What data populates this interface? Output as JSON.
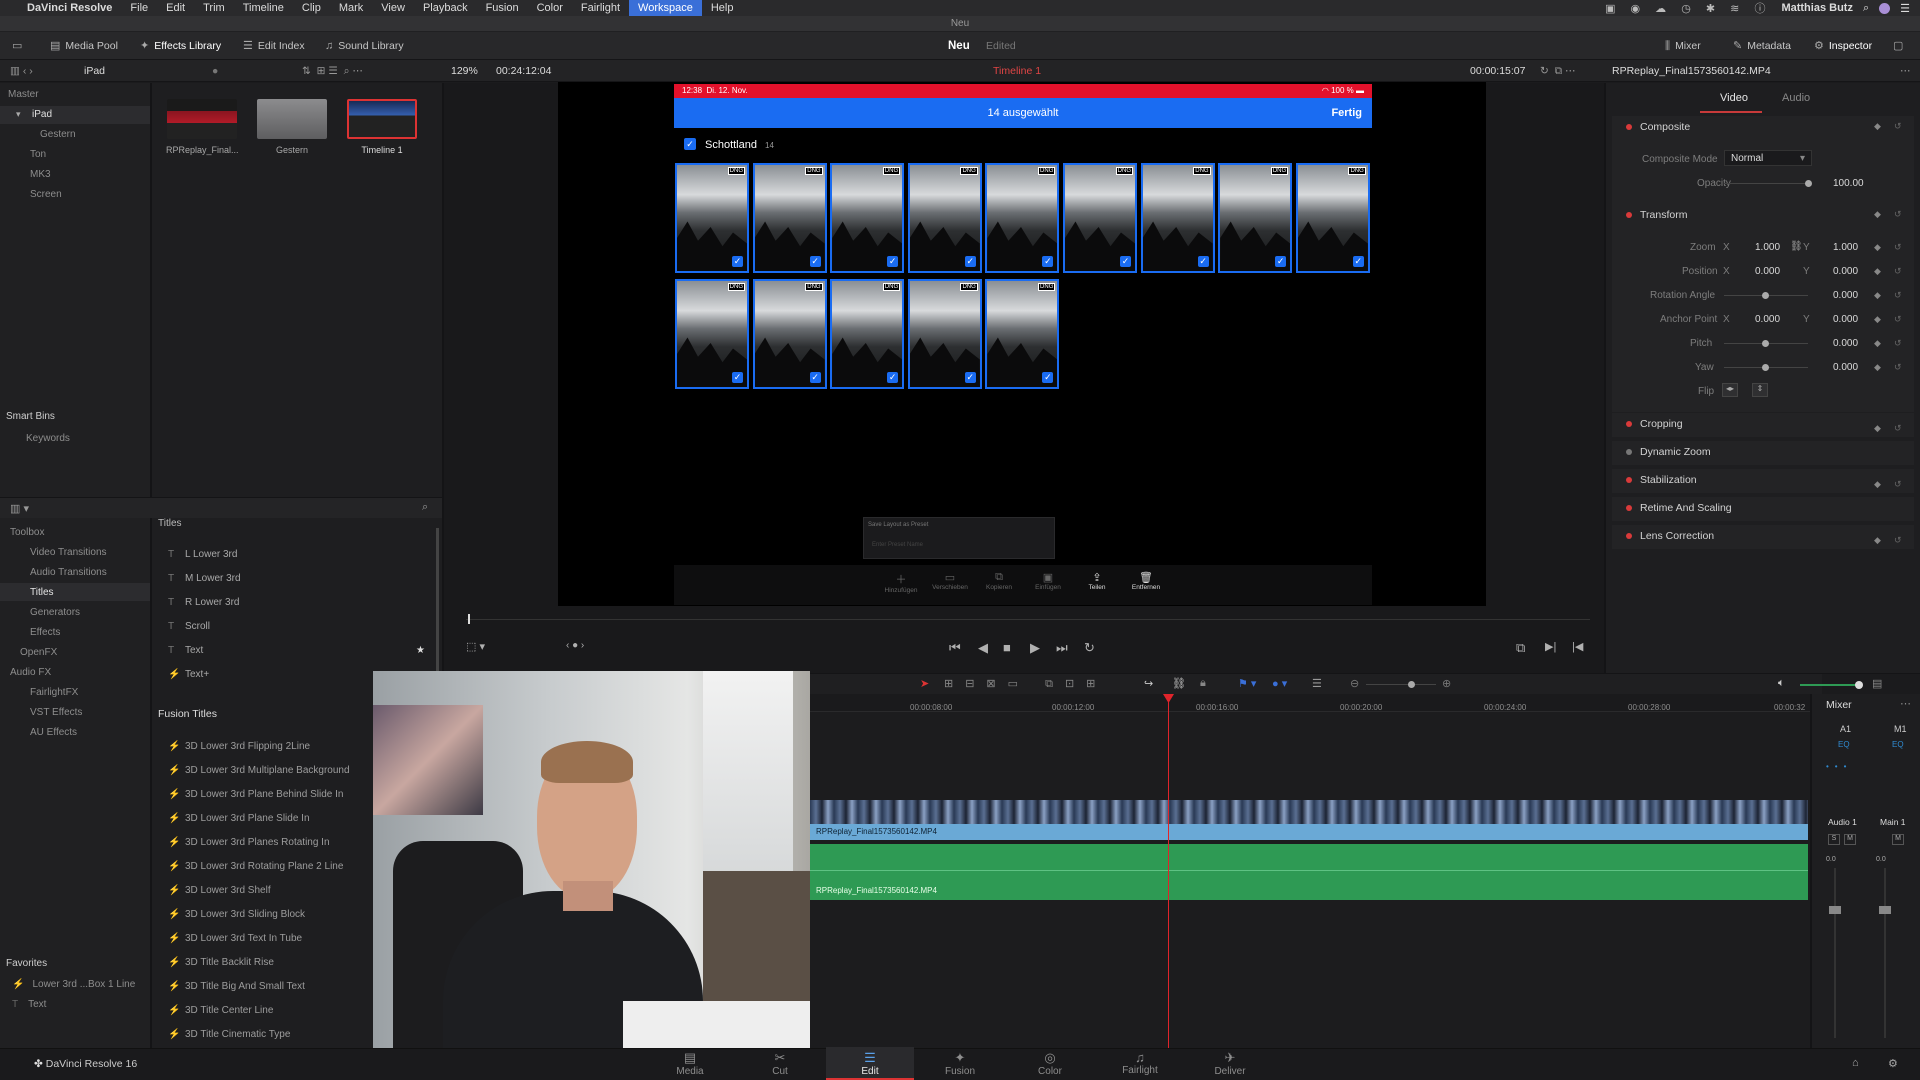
{
  "menubar": {
    "apple": "",
    "app": "DaVinci Resolve",
    "items": [
      "File",
      "Edit",
      "Trim",
      "Timeline",
      "Clip",
      "Mark",
      "View",
      "Playback",
      "Fusion",
      "Color",
      "Fairlight",
      "Workspace",
      "Help"
    ],
    "selected": "Workspace",
    "user": "Matthias Butz"
  },
  "window_title": "Neu",
  "toolbar": {
    "media_pool": "Media Pool",
    "effects_library": "Effects Library",
    "edit_index": "Edit Index",
    "sound_library": "Sound Library",
    "project": "Neu",
    "status": "Edited",
    "mixer": "Mixer",
    "metadata": "Metadata",
    "inspector": "Inspector"
  },
  "subbar": {
    "bin": "iPad",
    "zoom": "129%",
    "timecode_left": "00:24:12:04",
    "timeline": "Timeline 1",
    "timecode_right": "00:00:15:07",
    "clip_name": "RPReplay_Final1573560142.MP4"
  },
  "media_pool": {
    "bins": [
      "Master",
      "iPad",
      "Gestern",
      "Ton",
      "MK3",
      "Screen"
    ],
    "selected_bin": "iPad",
    "clips": [
      {
        "name": "RPReplay_Final..."
      },
      {
        "name": "Gestern"
      },
      {
        "name": "Timeline 1"
      }
    ],
    "smart_bins": "Smart Bins",
    "keywords": "Keywords"
  },
  "effects": {
    "tree": [
      {
        "label": "Toolbox",
        "level": 0
      },
      {
        "label": "Video Transitions",
        "level": 1
      },
      {
        "label": "Audio Transitions",
        "level": 1
      },
      {
        "label": "Titles",
        "level": 1
      },
      {
        "label": "Generators",
        "level": 1
      },
      {
        "label": "Effects",
        "level": 1
      },
      {
        "label": "OpenFX",
        "level": 0
      },
      {
        "label": "Audio FX",
        "level": 0
      },
      {
        "label": "FairlightFX",
        "level": 1
      },
      {
        "label": "VST Effects",
        "level": 1
      },
      {
        "label": "AU Effects",
        "level": 1
      }
    ],
    "selected": "Titles",
    "titles_header": "Titles",
    "titles": [
      "L Lower 3rd",
      "M Lower 3rd",
      "R Lower 3rd",
      "Scroll",
      "Text",
      "Text+"
    ],
    "fusion_titles_header": "Fusion Titles",
    "fusion_titles": [
      "3D Lower 3rd Flipping 2Line",
      "3D Lower 3rd Multiplane Background",
      "3D Lower 3rd Plane Behind Slide In",
      "3D Lower 3rd Plane Slide In",
      "3D Lower 3rd Planes Rotating In",
      "3D Lower 3rd Rotating Plane 2 Line",
      "3D Lower 3rd Shelf",
      "3D Lower 3rd Sliding Block",
      "3D Lower 3rd Text In Tube",
      "3D Title Backlit Rise",
      "3D Title Big And Small Text",
      "3D Title Center Line",
      "3D Title Cinematic Type"
    ],
    "favorites_header": "Favorites",
    "favorites": [
      "Lower 3rd ...Box 1 Line",
      "Text"
    ]
  },
  "viewer": {
    "phone_time": "12:38",
    "phone_date": "Di. 12. Nov.",
    "battery": "100 %",
    "selected_count": "14 ausgewählt",
    "done": "Fertig",
    "album": "Schottland",
    "album_count": "14",
    "badge": "DNG",
    "popup_title": "Save Layout as Preset",
    "popup_field": "Enter Preset Name",
    "actions": [
      "Hinzufügen",
      "Verschieben",
      "Kopieren",
      "Einfügen",
      "Teilen",
      "Entfernen"
    ]
  },
  "inspector": {
    "tabs": [
      "Video",
      "Audio"
    ],
    "selected_tab": "Video",
    "composite": "Composite",
    "composite_mode_label": "Composite Mode",
    "composite_mode": "Normal",
    "opacity_label": "Opacity",
    "opacity": "100.00",
    "transform": "Transform",
    "zoom_label": "Zoom",
    "zoom_x": "1.000",
    "zoom_y": "1.000",
    "position_label": "Position",
    "position_x": "0.000",
    "position_y": "0.000",
    "rotation_label": "Rotation Angle",
    "rotation": "0.000",
    "anchor_label": "Anchor Point",
    "anchor_x": "0.000",
    "anchor_y": "0.000",
    "pitch_label": "Pitch",
    "pitch": "0.000",
    "yaw_label": "Yaw",
    "yaw": "0.000",
    "flip_label": "Flip",
    "x": "X",
    "y": "Y",
    "sections": [
      "Cropping",
      "Dynamic Zoom",
      "Stabilization",
      "Retime And Scaling",
      "Lens Correction"
    ]
  },
  "timeline": {
    "ruler": [
      "00:00:08:00",
      "00:00:12:00",
      "00:00:16:00",
      "00:00:20:00",
      "00:00:24:00",
      "00:00:28:00",
      "00:00:32"
    ],
    "video_clip": "RPReplay_Final1573560142.MP4",
    "audio_clip": "RPReplay_Final1573560142.MP4"
  },
  "mixer": {
    "title": "Mixer",
    "a1": "A1",
    "m1": "M1",
    "eq": "EQ",
    "audio1": "Audio 1",
    "main1": "Main 1",
    "s": "S",
    "m": "M",
    "db1": "0.0",
    "db2": "0.0"
  },
  "bottom": {
    "app_version": "DaVinci Resolve 16",
    "pages": [
      "Media",
      "Cut",
      "Edit",
      "Fusion",
      "Color",
      "Fairlight",
      "Deliver"
    ],
    "selected": "Edit"
  },
  "colors": {
    "accent": "#1a6cf2",
    "playhead": "#e0242b",
    "audio_clip": "#2e9a54",
    "video_clip": "#6aa9d6"
  }
}
